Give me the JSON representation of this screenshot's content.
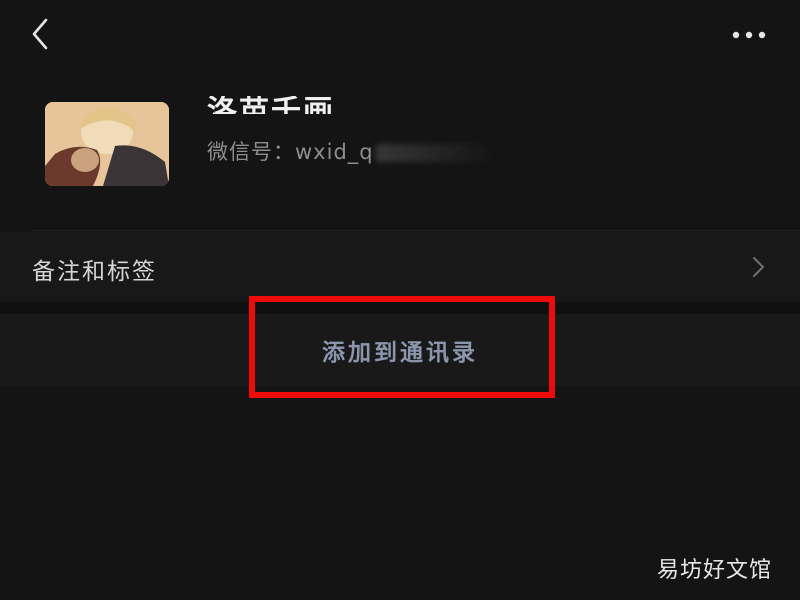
{
  "header": {
    "back_icon": "chevron-left-icon",
    "more_icon": "more-horizontal-icon"
  },
  "profile": {
    "nickname": "洛苗千画",
    "wechat_id_label": "微信号：",
    "wechat_id_value": "wxid_q"
  },
  "menu": {
    "remark_label": "备注和标签",
    "remark_icon": "chevron-right-icon"
  },
  "actions": {
    "add_contact_label": "添加到通讯录",
    "highlight_color": "#ee0b0b"
  },
  "watermark": {
    "text": "易坊好文馆"
  }
}
